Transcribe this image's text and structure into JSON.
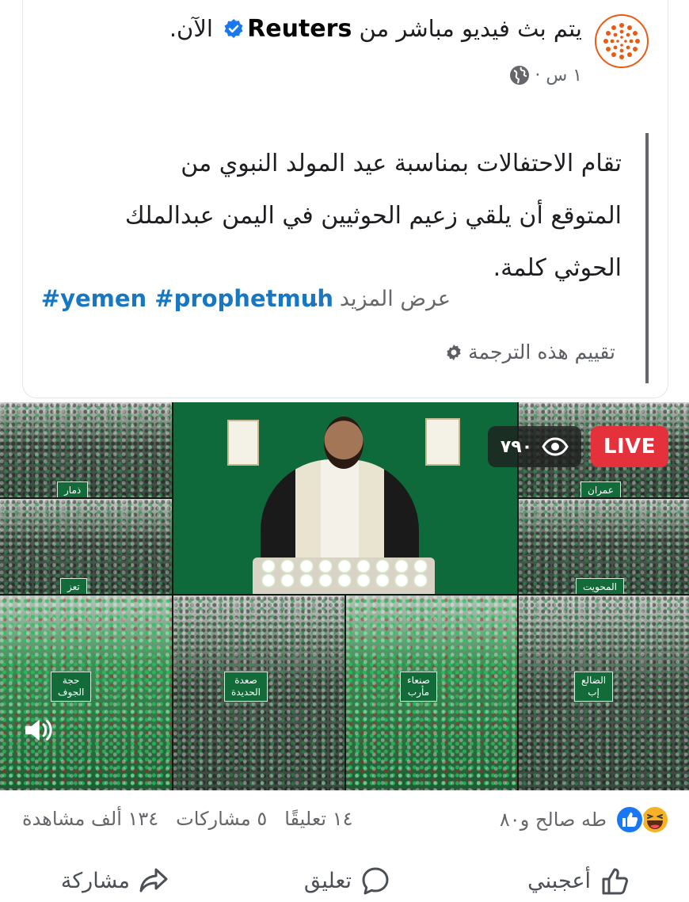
{
  "post": {
    "page_name": "Reuters",
    "header_prefix": "يتم بث فيديو مباشر من",
    "header_suffix": "الآن.",
    "timestamp": "١ س ·",
    "text": "تقام الاحتفالات بمناسبة عيد المولد النبوي من المتوقع أن يلقي زعيم الحوثيين في اليمن عبدالملك الحوثي كلمة.",
    "see_more": "عرض المزيد ...",
    "hashtags": "#yemen #prophetmuh",
    "rate_translation": "تقييم هذه الترجمة"
  },
  "video": {
    "live_label": "LIVE",
    "viewers": "٧٩٠",
    "regions": {
      "dhamar": "ذمار",
      "taiz": "تعز",
      "amran": "عمران",
      "mahwit": "المحويت",
      "hajjah_jawf": "حجة\nالجوف",
      "saada_hodeidah": "صعدة\nالحديدة",
      "sanaa_marib": "صنعاء\nمأرب",
      "dhale_ibb": "الضالع\nإب"
    }
  },
  "stats": {
    "reactors": "طه صالح و٨٠",
    "views": "١٣٤ ألف مشاهدة",
    "shares": "٥ مشاركات",
    "comments": "١٤ تعليقًا"
  },
  "actions": {
    "like": "أعجبني",
    "comment": "تعليق",
    "share": "مشاركة"
  },
  "colors": {
    "live_red": "#e4313b",
    "hashtag_blue": "#1877c2",
    "like_blue": "#1877f2",
    "haha_yellow": "#f7b125",
    "reuters_orange": "#eb5a14"
  },
  "icons": [
    "reuters-logo-icon",
    "verified-badge-icon",
    "globe-icon",
    "gear-icon",
    "eye-icon",
    "speaker-icon",
    "like-reaction-icon",
    "haha-reaction-icon",
    "thumbs-up-icon",
    "comment-icon",
    "share-icon"
  ]
}
